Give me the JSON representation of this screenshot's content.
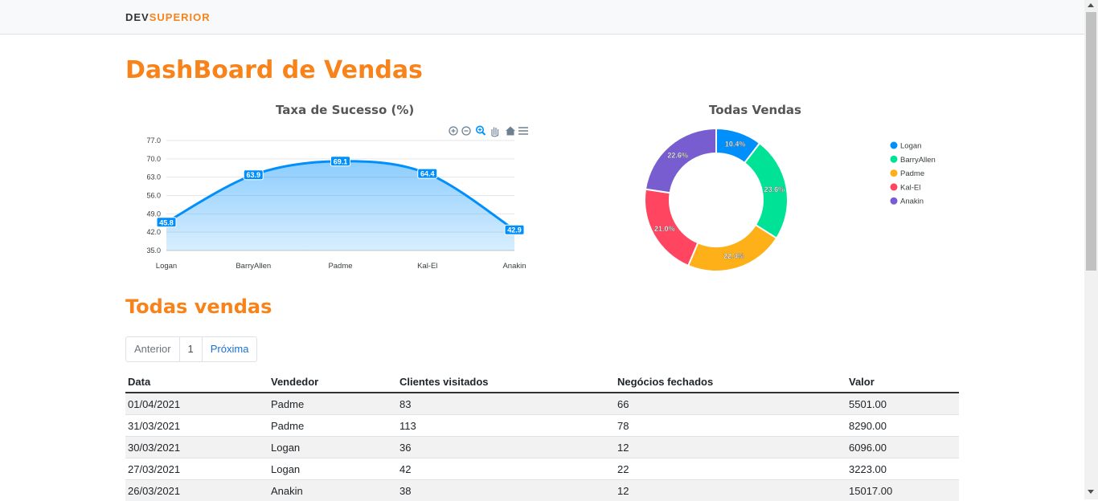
{
  "brand": {
    "part1": "DEV",
    "part2": "SUPERIOR"
  },
  "page_title": "DashBoard de Vendas",
  "section_title": "Todas vendas",
  "colors": {
    "accent": "#f8831b",
    "link": "#1a6fd6"
  },
  "toolbar_icons": [
    "zoom-in-icon",
    "zoom-out-icon",
    "zoom-selection-icon",
    "pan-hand-icon",
    "home-reset-icon",
    "menu-icon"
  ],
  "pagination": {
    "prev": "Anterior",
    "page": "1",
    "next": "Próxima"
  },
  "table": {
    "headers": [
      "Data",
      "Vendedor",
      "Clientes visitados",
      "Negócios fechados",
      "Valor"
    ],
    "rows": [
      [
        "01/04/2021",
        "Padme",
        "83",
        "66",
        "5501.00"
      ],
      [
        "31/03/2021",
        "Padme",
        "113",
        "78",
        "8290.00"
      ],
      [
        "30/03/2021",
        "Logan",
        "36",
        "12",
        "6096.00"
      ],
      [
        "27/03/2021",
        "Logan",
        "42",
        "22",
        "3223.00"
      ],
      [
        "26/03/2021",
        "Anakin",
        "38",
        "12",
        "15017.00"
      ]
    ]
  },
  "chart_data": [
    {
      "type": "area",
      "title": "Taxa de Sucesso (%)",
      "categories": [
        "Logan",
        "BarryAllen",
        "Padme",
        "Kal-El",
        "Anakin"
      ],
      "values": [
        45.8,
        63.9,
        69.1,
        64.4,
        42.9
      ],
      "ylim": [
        35,
        77
      ],
      "yticks": [
        "77.0",
        "70.0",
        "63.0",
        "56.0",
        "49.0",
        "42.0",
        "35.0"
      ],
      "grid": true,
      "color": "#008ffb"
    },
    {
      "type": "pie",
      "title": "Todas Vendas",
      "categories": [
        "Logan",
        "BarryAllen",
        "Padme",
        "Kal-El",
        "Anakin"
      ],
      "values": [
        10.4,
        23.6,
        22.4,
        21.0,
        22.6
      ],
      "labels": [
        "10.4%",
        "23.6%",
        "22.4%",
        "21.0%",
        "22.6%"
      ],
      "colors": [
        "#008ffb",
        "#00e396",
        "#feb019",
        "#ff4560",
        "#775dd0"
      ],
      "legend": "right"
    }
  ]
}
